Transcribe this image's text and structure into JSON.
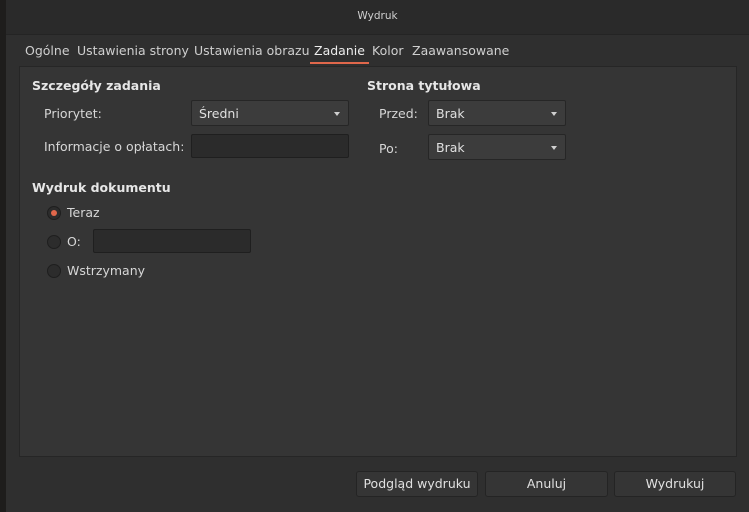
{
  "window": {
    "title": "Wydruk"
  },
  "tabs": [
    {
      "label": "Ogólne",
      "active": false
    },
    {
      "label": "Ustawienia strony",
      "active": false
    },
    {
      "label": "Ustawienia obrazu",
      "active": false
    },
    {
      "label": "Zadanie",
      "active": true
    },
    {
      "label": "Kolor",
      "active": false
    },
    {
      "label": "Zaawansowane",
      "active": false
    }
  ],
  "job_details": {
    "heading": "Szczegóły zadania",
    "priority_label": "Priorytet:",
    "priority_value": "Średni",
    "billing_label": "Informacje o opłatach:",
    "billing_value": ""
  },
  "cover_page": {
    "heading": "Strona tytułowa",
    "before_label": "Przed:",
    "before_value": "Brak",
    "after_label": "Po:",
    "after_value": "Brak"
  },
  "print_document": {
    "heading": "Wydruk dokumentu",
    "options": [
      {
        "label": "Teraz",
        "checked": true
      },
      {
        "label": "O:",
        "checked": false
      },
      {
        "label": "Wstrzymany",
        "checked": false
      }
    ],
    "at_time_value": ""
  },
  "buttons": {
    "preview": "Podgląd wydruku",
    "cancel": "Anuluj",
    "print": "Wydrukuj"
  },
  "colors": {
    "accent": "#e0674b",
    "background": "#2f2f2f"
  }
}
